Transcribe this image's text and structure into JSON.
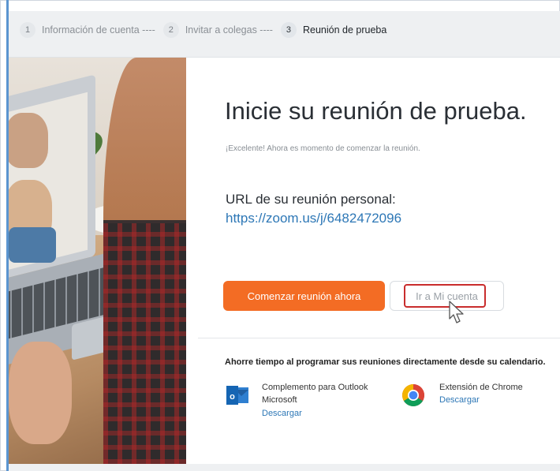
{
  "stepper": {
    "steps": [
      {
        "number": "1",
        "label": "Información de cuenta ----"
      },
      {
        "number": "2",
        "label": "Invitar a colegas ----"
      },
      {
        "number": "3",
        "label": "Reunión de prueba"
      }
    ],
    "active_step": 3
  },
  "main": {
    "title": "Inicie su reunión de prueba.",
    "subtitle": "¡Excelente! Ahora es momento de comenzar la reunión.",
    "url_label": "URL de su reunión personal:",
    "url": "https://zoom.us/j/6482472096",
    "start_button": "Comenzar reunión ahora",
    "account_button": "Ir a Mi cuenta",
    "calendar_text": "Ahorre tiempo al programar sus reuniones directamente desde su calendario.",
    "extensions": [
      {
        "title_line1": "Complemento para Outlook",
        "title_line2": "Microsoft",
        "link": "Descargar",
        "icon": "outlook-icon"
      },
      {
        "title_line1": "Extensión de Chrome",
        "link": "Descargar",
        "icon": "chrome-icon"
      }
    ]
  },
  "colors": {
    "primary_button": "#f36c24",
    "link": "#2d77b6",
    "highlight": "#c92d2d"
  }
}
